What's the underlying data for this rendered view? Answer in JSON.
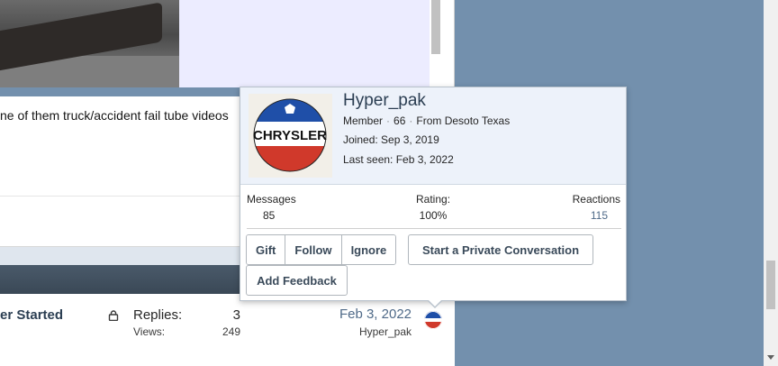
{
  "post": {
    "text": "ne of them truck/accident fail tube videos"
  },
  "thread_row": {
    "title_fragment": "er Started",
    "replies_label": "Replies:",
    "replies_value": "3",
    "views_label": "Views:",
    "views_value": "249",
    "last_post_date": "Feb 3, 2022",
    "last_post_user": "Hyper_pak"
  },
  "member_tooltip": {
    "username": "Hyper_pak",
    "role": "Member",
    "age": "66",
    "location": "From Desoto Texas",
    "joined": "Joined: Sep 3, 2019",
    "last_seen": "Last seen: Feb 3, 2022",
    "avatar_text": "CHRYSLER",
    "stats": {
      "messages_label": "Messages",
      "messages_value": "85",
      "rating_label": "Rating:",
      "rating_value": "100%",
      "reactions_label": "Reactions",
      "reactions_value": "115"
    },
    "buttons": {
      "gift": "Gift",
      "follow": "Follow",
      "ignore": "Ignore",
      "private_conversation": "Start a Private Conversation",
      "add_feedback": "Add Feedback"
    }
  },
  "icons": {
    "lock": "lock-icon",
    "avatar_logo": "chrysler-logo"
  },
  "colors": {
    "page_background": "#7390ad",
    "link_blue": "#4f6a88",
    "tooltip_header": "#edf2fa",
    "chrysler_red": "#d0392b",
    "chrysler_blue": "#1f4fa8"
  }
}
